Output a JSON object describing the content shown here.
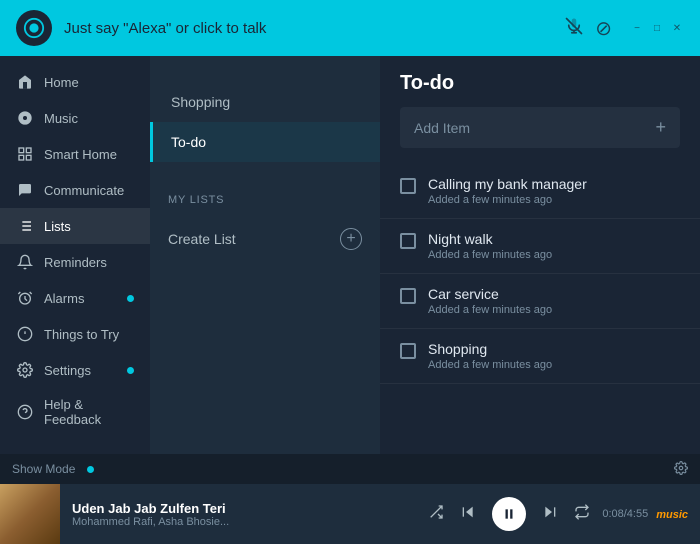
{
  "header": {
    "logo_alt": "Alexa logo",
    "tagline": "Just say \"Alexa\" or click to talk",
    "mic_icon": "mic-muted-icon",
    "settings_icon": "settings-icon",
    "min_btn": "−",
    "max_btn": "□",
    "close_btn": "✕"
  },
  "sidebar": {
    "items": [
      {
        "id": "home",
        "label": "Home",
        "icon": "home-icon",
        "dot": false
      },
      {
        "id": "music",
        "label": "Music",
        "icon": "music-icon",
        "dot": false
      },
      {
        "id": "smart-home",
        "label": "Smart Home",
        "icon": "smarthome-icon",
        "dot": false
      },
      {
        "id": "communicate",
        "label": "Communicate",
        "icon": "communicate-icon",
        "dot": false
      },
      {
        "id": "lists",
        "label": "Lists",
        "icon": "lists-icon",
        "dot": false,
        "active": true
      },
      {
        "id": "reminders",
        "label": "Reminders",
        "icon": "reminders-icon",
        "dot": false
      },
      {
        "id": "alarms",
        "label": "Alarms",
        "icon": "alarms-icon",
        "dot": true
      },
      {
        "id": "things-to-try",
        "label": "Things to Try",
        "icon": "things-icon",
        "dot": false
      },
      {
        "id": "settings",
        "label": "Settings",
        "icon": "settings-icon",
        "dot": true
      },
      {
        "id": "help-feedback",
        "label": "Help & Feedback",
        "icon": "help-icon",
        "dot": false
      }
    ]
  },
  "middle_panel": {
    "list_items": [
      {
        "id": "shopping",
        "label": "Shopping",
        "active": false
      },
      {
        "id": "todo",
        "label": "To-do",
        "active": true
      }
    ],
    "my_lists_header": "MY LISTS",
    "create_list_label": "Create List"
  },
  "todo_panel": {
    "title": "To-do",
    "add_item_placeholder": "Add Item",
    "items": [
      {
        "id": 1,
        "title": "Calling my bank manager",
        "sub": "Added a few minutes ago",
        "checked": false
      },
      {
        "id": 2,
        "title": "Night walk",
        "sub": "Added a few minutes ago",
        "checked": false
      },
      {
        "id": 3,
        "title": "Car service",
        "sub": "Added a few minutes ago",
        "checked": false
      },
      {
        "id": 4,
        "title": "Shopping",
        "sub": "Added a few minutes ago",
        "checked": false
      }
    ]
  },
  "player": {
    "album_art_alt": "album art",
    "title": "Uden Jab Jab Zulfen Teri",
    "artist": "Mohammed Rafi, Asha Bhosie...",
    "time_current": "0:08",
    "time_total": "4:55",
    "time_display": "0:08/4:55",
    "music_brand": "music",
    "controls": {
      "shuffle": "shuffle-icon",
      "prev": "prev-icon",
      "play_pause": "pause-icon",
      "next": "next-icon",
      "repeat": "repeat-icon"
    }
  },
  "bottom_bar": {
    "show_mode_label": "Show Mode",
    "gear_icon": "gear-icon"
  }
}
